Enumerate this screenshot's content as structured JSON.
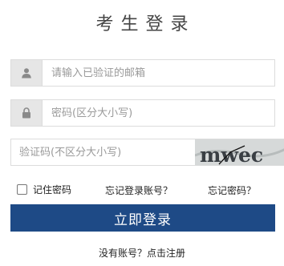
{
  "header": {
    "title": "考生登录"
  },
  "form": {
    "email_placeholder": "请输入已验证的邮箱",
    "password_placeholder": "密码(区分大小写)",
    "captcha_placeholder": "验证码(不区分大小写)",
    "captcha_image_text": "mwec",
    "icons": {
      "email": "user-icon",
      "password": "lock-icon"
    }
  },
  "options": {
    "remember_label": "记住密码",
    "forgot_account": "忘记登录账号？",
    "forgot_password": "忘记密码？"
  },
  "actions": {
    "login_label": "立即登录"
  },
  "footer": {
    "register_prompt": "没有账号？",
    "register_link": "点击注册"
  },
  "colors": {
    "primary": "#1e4a86",
    "addon_bg": "#e6e6e6",
    "border": "#dcdcdc"
  }
}
